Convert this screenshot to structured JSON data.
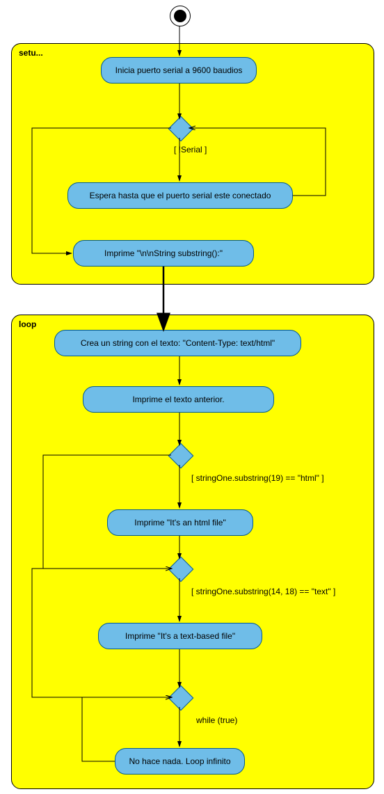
{
  "diagram": {
    "type": "uml_activity_diagram",
    "initial_node": true,
    "partitions": [
      {
        "name": "setu...",
        "id": "setup"
      },
      {
        "name": "loop",
        "id": "loop"
      }
    ],
    "setup": {
      "label": "setu...",
      "a1": "Inicia puerto serial a 9600 baudios",
      "d1_guard": "[ !Serial ]",
      "a2": "Espera hasta que el puerto serial este conectado",
      "a3": "Imprime  \"\\n\\nString  substring():\""
    },
    "loop": {
      "label": "loop",
      "a4": "Crea un string con el texto: \"Content-Type: text/html\"",
      "a5": "Imprime el texto anterior.",
      "d2_guard": "[  stringOne.substring(19) == \"html\"  ]",
      "a6": "Imprime \"It's an html file\"",
      "d3_guard": "[  stringOne.substring(14, 18) == \"text\"  ]",
      "a7": "Imprime \"It's a text-based file\"",
      "d4_guard": "while (true)",
      "a8": "No hace nada. Loop infinito"
    }
  }
}
